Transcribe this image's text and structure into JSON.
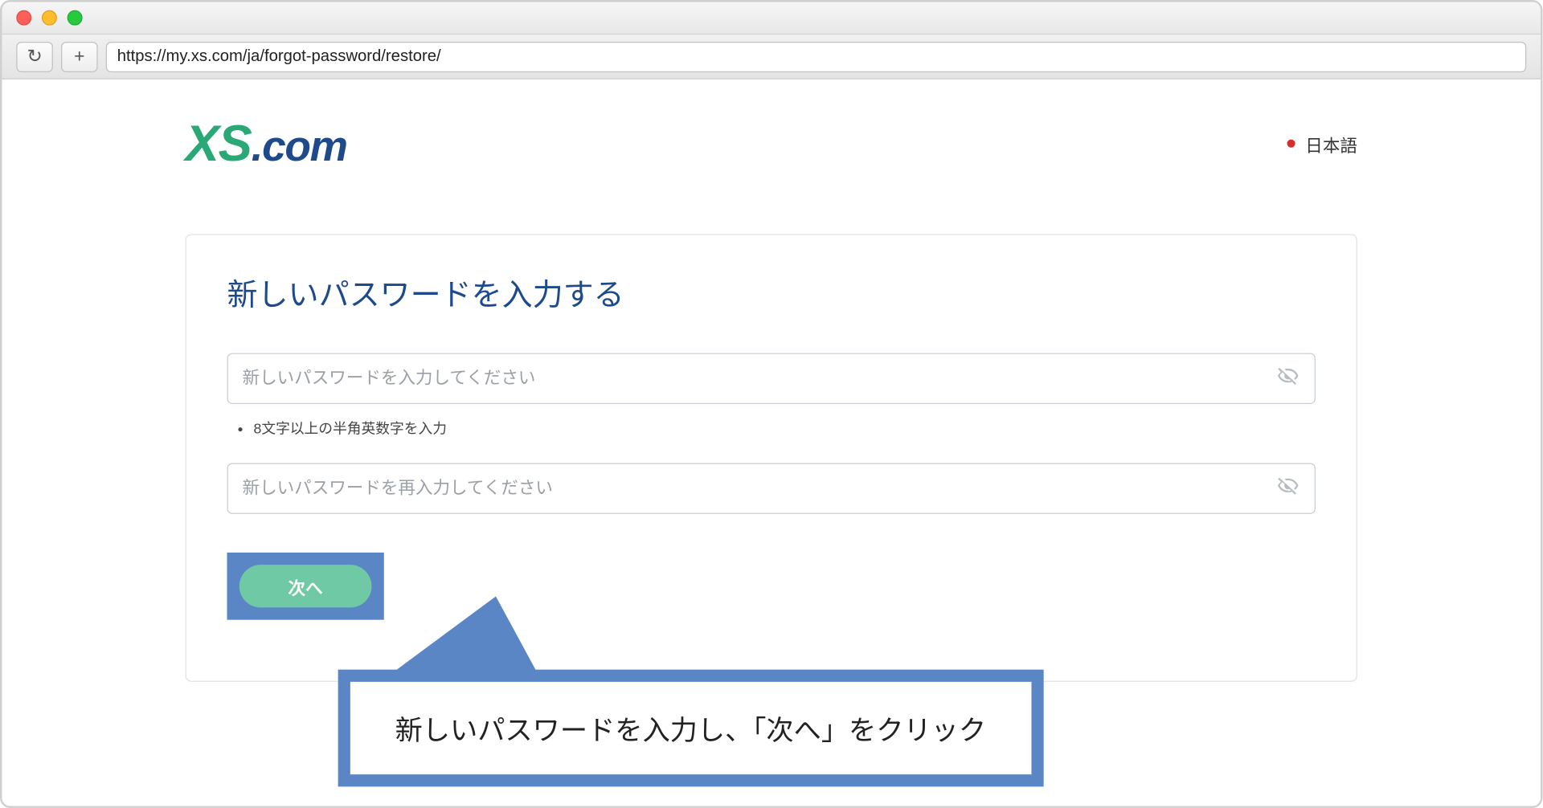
{
  "browser": {
    "url": "https://my.xs.com/ja/forgot-password/restore/"
  },
  "header": {
    "logo_xs": "XS",
    "logo_dotcom": ".com",
    "language_label": "日本語"
  },
  "card": {
    "title": "新しいパスワードを入力する",
    "password_placeholder": "新しいパスワードを入力してください",
    "rules": [
      "8文字以上の半角英数字を入力"
    ],
    "confirm_placeholder": "新しいパスワードを再入力してください",
    "next_label": "次へ"
  },
  "callout": {
    "text": "新しいパスワードを入力し、「次へ」をクリック"
  },
  "colors": {
    "accent_blue": "#5a86c5",
    "heading_navy": "#1e4a8c",
    "button_green": "#6fc9a4",
    "logo_green": "#2aa876"
  }
}
